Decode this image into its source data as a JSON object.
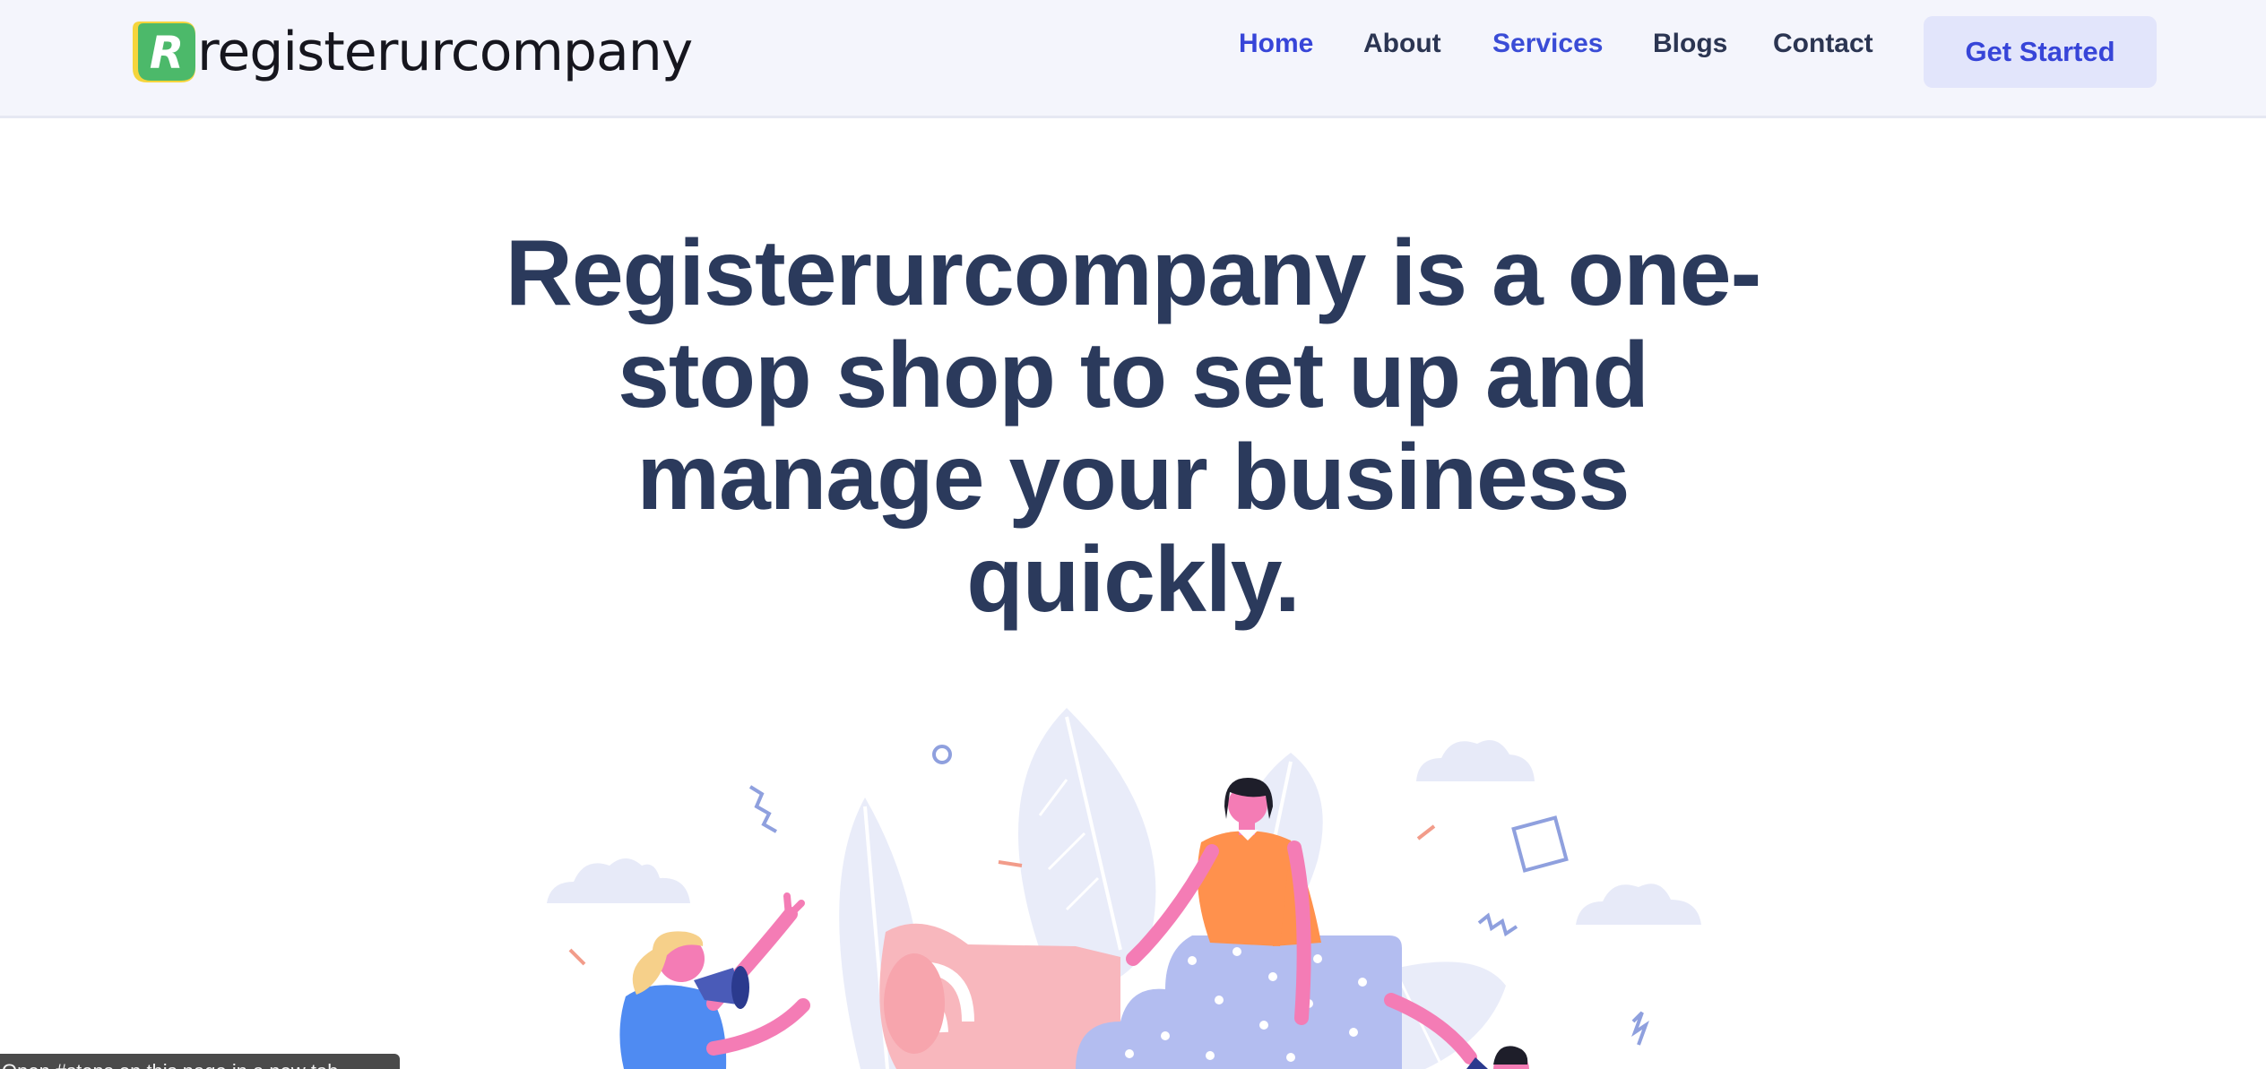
{
  "logo": {
    "text": "registerurcompany",
    "mark_letter": "R"
  },
  "nav": {
    "items": [
      {
        "label": "Home",
        "state": "active"
      },
      {
        "label": "About",
        "state": "default"
      },
      {
        "label": "Services",
        "state": "highlighted"
      },
      {
        "label": "Blogs",
        "state": "default"
      },
      {
        "label": "Contact",
        "state": "default"
      }
    ],
    "cta_label": "Get Started"
  },
  "hero": {
    "title": "Registerurcompany is a one-stop shop to set up and manage your business quickly."
  },
  "status_bar": {
    "text": "Open #steps on this page in a new tab"
  },
  "colors": {
    "brand_green": "#4cb96a",
    "brand_yellow": "#f5d53c",
    "nav_active": "#3745d8",
    "heading": "#2b3a5c",
    "header_bg": "#f4f5fc",
    "cta_bg": "#e2e5fb"
  }
}
